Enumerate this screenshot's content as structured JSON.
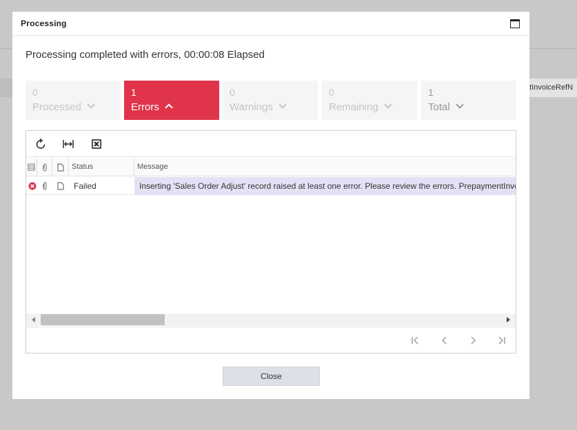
{
  "background": {
    "column_label": "ntInvoiceRefN"
  },
  "dialog": {
    "title": "Processing",
    "maximize_icon": "window-maximize-icon",
    "status_message": "Processing completed with errors, 00:00:08 Elapsed",
    "colors": {
      "active_tile": "#e0344b",
      "selected_cell": "#e6e0f5",
      "error_icon": "#e0344b"
    },
    "tiles": [
      {
        "count": "0",
        "label": "Processed",
        "active": false
      },
      {
        "count": "1",
        "label": "Errors",
        "active": true
      },
      {
        "count": "0",
        "label": "Warnings",
        "active": false
      },
      {
        "count": "0",
        "label": "Remaining",
        "active": false
      },
      {
        "count": "1",
        "label": "Total",
        "active": false
      }
    ],
    "toolbar": {
      "refresh_icon": "refresh-icon",
      "fit_columns_icon": "fit-columns-icon",
      "export_excel_icon": "export-excel-icon"
    },
    "grid": {
      "columns": [
        "",
        "",
        "",
        "Status",
        "Message"
      ],
      "rows": [
        {
          "status": "Failed",
          "message": "Inserting 'Sales Order Adjust' record raised at least one error. Please review the errors. PrepaymentInvoiceRefNbr: 'PrepaymentInvoiceRefNbr' cannot be empty."
        }
      ]
    },
    "close_label": "Close"
  }
}
